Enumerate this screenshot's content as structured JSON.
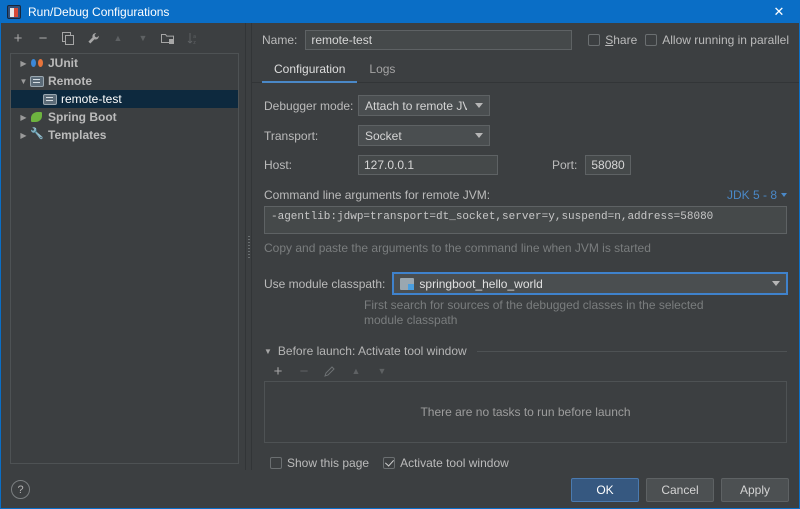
{
  "window": {
    "title": "Run/Debug Configurations",
    "app_icon": "intellij-icon",
    "close_label": "✕"
  },
  "left_toolbar": {
    "items": [
      {
        "name": "add-configuration-button",
        "glyph": "+",
        "enabled": true
      },
      {
        "name": "remove-configuration-button",
        "glyph": "−",
        "enabled": true
      },
      {
        "name": "copy-configuration-button",
        "glyph": "copy-icon",
        "enabled": true
      },
      {
        "name": "edit-templates-button",
        "glyph": "wrench-icon",
        "enabled": true
      },
      {
        "name": "move-up-button",
        "glyph": "▲",
        "enabled": false
      },
      {
        "name": "move-down-button",
        "glyph": "▼",
        "enabled": false
      },
      {
        "name": "move-into-folder-button",
        "glyph": "folder-add-icon",
        "enabled": true
      },
      {
        "name": "sort-configurations-button",
        "glyph": "sort-az-icon",
        "enabled": false
      }
    ]
  },
  "tree": {
    "nodes": [
      {
        "label": "JUnit",
        "icon": "junit-icon",
        "twisty": "▶",
        "indent": 0,
        "selected": false,
        "bold": true
      },
      {
        "label": "Remote",
        "icon": "remote-icon",
        "twisty": "▼",
        "indent": 0,
        "selected": false,
        "bold": true
      },
      {
        "label": "remote-test",
        "icon": "remote-icon",
        "twisty": "",
        "indent": 1,
        "selected": true,
        "bold": false
      },
      {
        "label": "Spring Boot",
        "icon": "spring-icon",
        "twisty": "▶",
        "indent": 0,
        "selected": false,
        "bold": true
      },
      {
        "label": "Templates",
        "icon": "wrench-icon",
        "twisty": "▶",
        "indent": 0,
        "selected": false,
        "bold": true
      }
    ]
  },
  "header": {
    "name_label": "Name:",
    "name_value": "remote-test",
    "share_label": "Share",
    "share_checked": false,
    "parallel_label": "Allow running in parallel",
    "parallel_checked": false
  },
  "tabs": [
    {
      "label": "Configuration",
      "active": true
    },
    {
      "label": "Logs",
      "active": false
    }
  ],
  "form": {
    "debugger_mode_label": "Debugger mode:",
    "debugger_mode_value": "Attach to remote JVM",
    "transport_label": "Transport:",
    "transport_value": "Socket",
    "host_label": "Host:",
    "host_value": "127.0.0.1",
    "port_label": "Port:",
    "port_value": "58080",
    "cmdline_label": "Command line arguments for remote JVM:",
    "jdk_link": "JDK 5 - 8",
    "cmdline_value": "-agentlib:jdwp=transport=dt_socket,server=y,suspend=n,address=58080",
    "cmdline_hint": "Copy and paste the arguments to the command line when JVM is started",
    "module_classpath_label": "Use module classpath:",
    "module_classpath_value": "springboot_hello_world",
    "module_classpath_hint": "First search for sources of the debugged classes in the selected\nmodule classpath"
  },
  "before_launch": {
    "header": "Before launch: Activate tool window",
    "toolbar": [
      {
        "name": "add-task-button",
        "glyph": "+",
        "enabled": true
      },
      {
        "name": "remove-task-button",
        "glyph": "−",
        "enabled": false
      },
      {
        "name": "edit-task-button",
        "glyph": "pencil-icon",
        "enabled": false
      },
      {
        "name": "task-move-up-button",
        "glyph": "▲",
        "enabled": false
      },
      {
        "name": "task-move-down-button",
        "glyph": "▼",
        "enabled": false
      }
    ],
    "empty_text": "There are no tasks to run before launch",
    "show_page_label": "Show this page",
    "show_page_checked": false,
    "activate_tool_window_label": "Activate tool window",
    "activate_tool_window_checked": true
  },
  "footer": {
    "help_label": "?",
    "ok_label": "OK",
    "cancel_label": "Cancel",
    "apply_label": "Apply"
  },
  "colors": {
    "titlebar": "#0a6ec6",
    "background": "#3c3f41",
    "selection": "#0d293e",
    "accent": "#4a88c7",
    "primary_button": "#365880"
  }
}
